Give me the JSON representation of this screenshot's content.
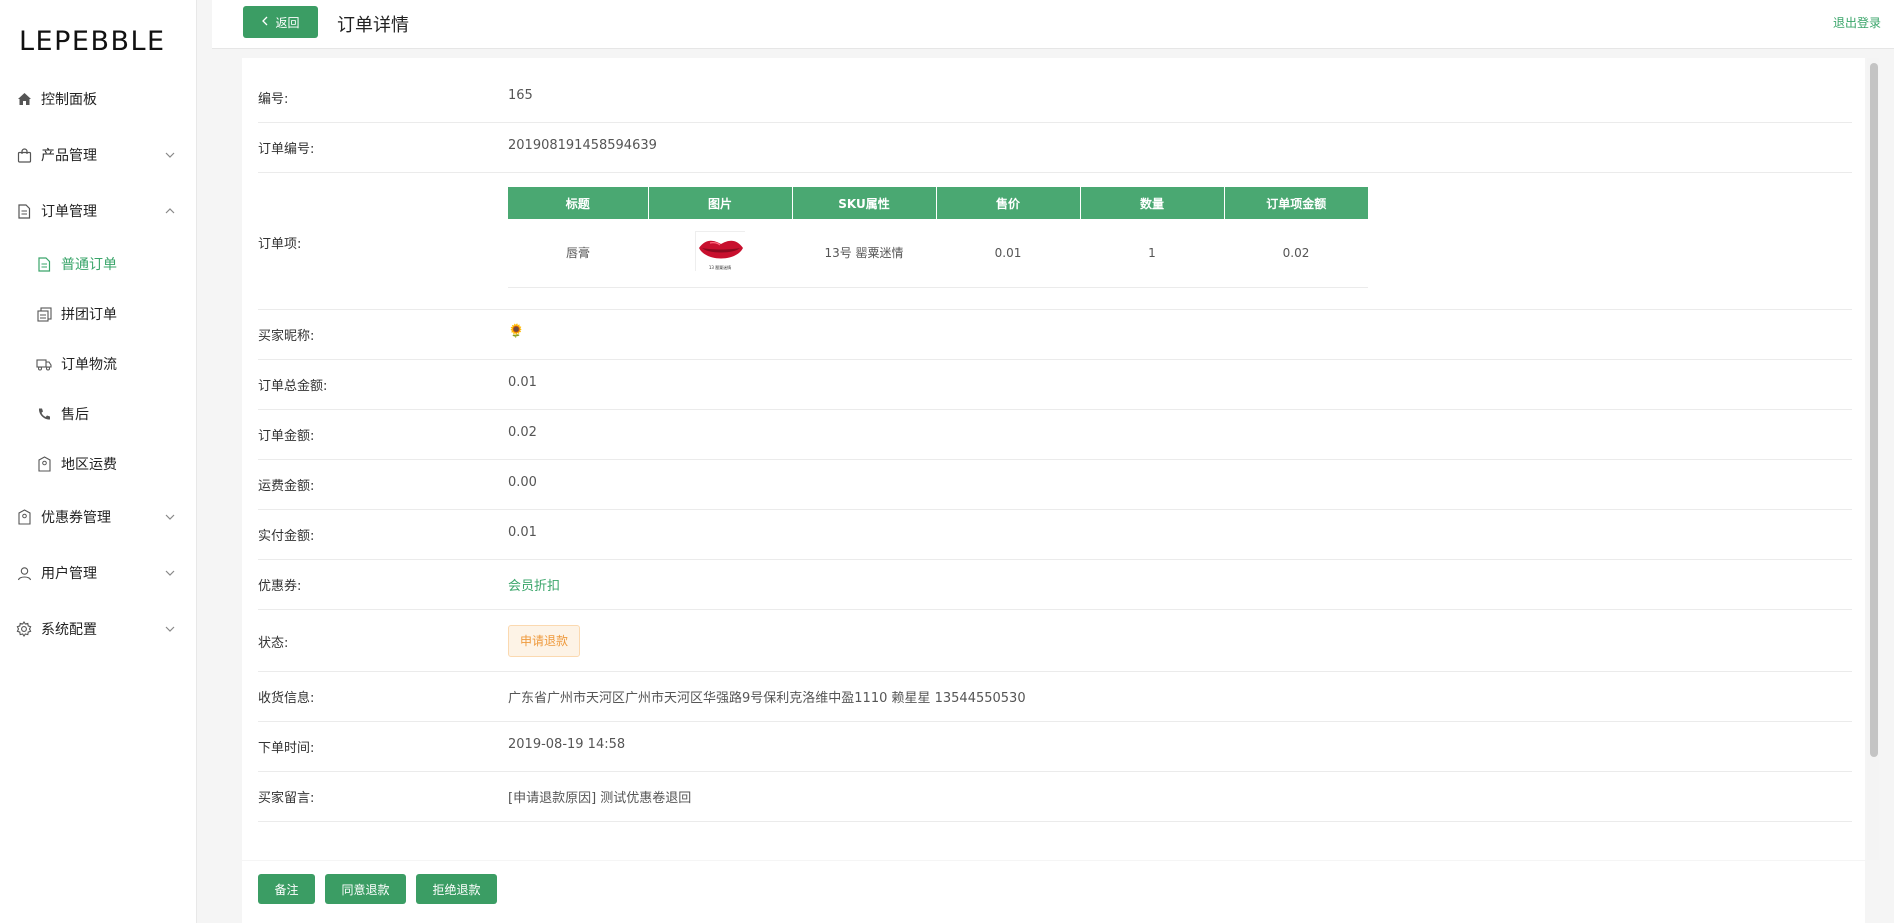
{
  "app": {
    "logo": "LEPEBBLE"
  },
  "sidebar": {
    "items": [
      {
        "label": "控制面板",
        "icon": "home-icon"
      },
      {
        "label": "产品管理",
        "icon": "shopping-bag-icon"
      },
      {
        "label": "订单管理",
        "icon": "document-icon"
      },
      {
        "label": "优惠券管理",
        "icon": "coupon-icon"
      },
      {
        "label": "用户管理",
        "icon": "user-icon"
      },
      {
        "label": "系统配置",
        "icon": "gear-icon"
      }
    ],
    "order_sub": [
      {
        "label": "普通订单",
        "icon": "document-icon",
        "active": true
      },
      {
        "label": "拼团订单",
        "icon": "copy-icon"
      },
      {
        "label": "订单物流",
        "icon": "truck-icon"
      },
      {
        "label": "售后",
        "icon": "phone-icon"
      },
      {
        "label": "地区运费",
        "icon": "location-icon"
      }
    ]
  },
  "header": {
    "back_label": "返回",
    "title": "订单详情",
    "logout": "退出登录"
  },
  "detail": {
    "id_label": "编号:",
    "id_value": "165",
    "order_no_label": "订单编号:",
    "order_no_value": "201908191458594639",
    "items_label": "订单项:",
    "items_headers": [
      "标题",
      "图片",
      "SKU属性",
      "售价",
      "数量",
      "订单项金额"
    ],
    "items_rows": [
      {
        "title": "唇膏",
        "sku": "13号 罂粟迷情",
        "price": "0.01",
        "qty": "1",
        "amount": "0.02",
        "img_caption": "13 罂粟迷情"
      }
    ],
    "buyer_label": "买家昵称:",
    "buyer_value": "🌻",
    "total_label": "订单总金额:",
    "total_value": "0.01",
    "amount_label": "订单金额:",
    "amount_value": "0.02",
    "freight_label": "运费金额:",
    "freight_value": "0.00",
    "paid_label": "实付金额:",
    "paid_value": "0.01",
    "coupon_label": "优惠券:",
    "coupon_value": "会员折扣",
    "status_label": "状态:",
    "status_value": "申请退款",
    "address_label": "收货信息:",
    "address_value": "广东省广州市天河区广州市天河区华强路9号保利克洛维中盈1110 赖星星 13544550530",
    "time_label": "下单时间:",
    "time_value": "2019-08-19 14:58",
    "note_label": "买家留言:",
    "note_value": "[申请退款原因] 测试优惠卷退回"
  },
  "footer": {
    "remark_btn": "备注",
    "agree_btn": "同意退款",
    "reject_btn": "拒绝退款"
  },
  "colors": {
    "primary": "#3b9d64",
    "accent_text": "#3aa56a",
    "tag_text": "#ee9a3d"
  }
}
